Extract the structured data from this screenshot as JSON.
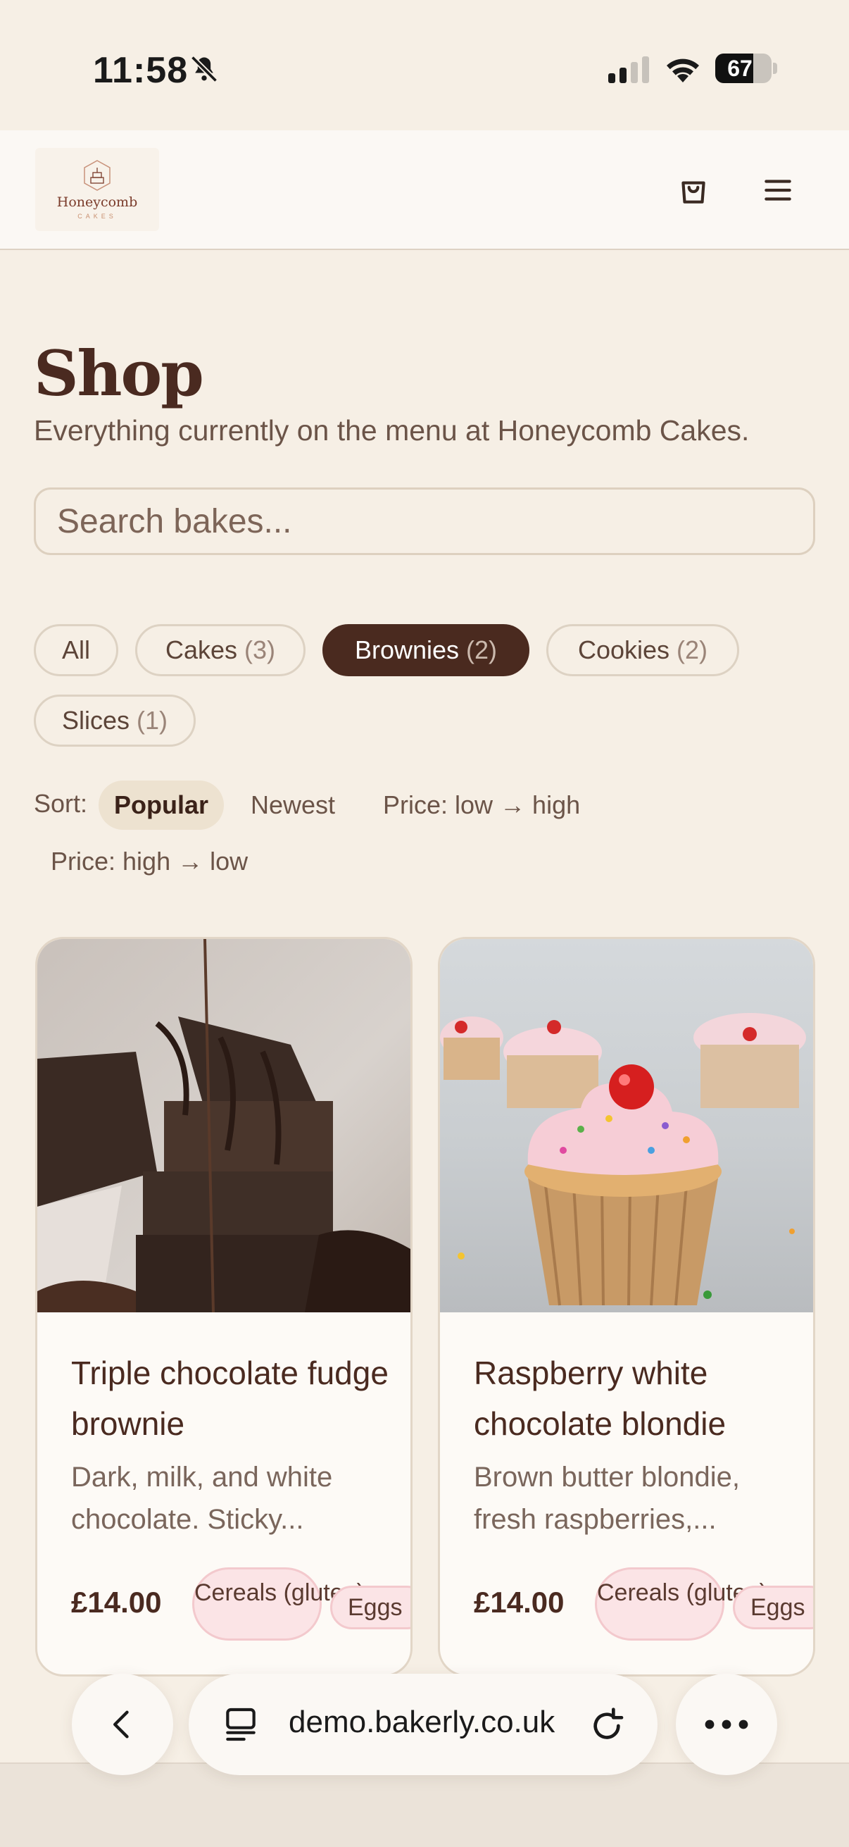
{
  "status_bar": {
    "time": "11:58",
    "battery": "67",
    "battery_level": 0.67
  },
  "header": {
    "logo_text": "Honeycomb",
    "logo_sub": "CAKES"
  },
  "page": {
    "title": "Shop",
    "subtitle": "Everything currently on the menu at Honeycomb Cakes.",
    "search_placeholder": "Search bakes..."
  },
  "filters": [
    {
      "label": "All",
      "count": ""
    },
    {
      "label": "Cakes",
      "count": "(3)"
    },
    {
      "label": "Brownies",
      "count": "(2)"
    },
    {
      "label": "Cookies",
      "count": "(2)"
    },
    {
      "label": "Slices",
      "count": "(1)"
    }
  ],
  "active_filter": "Brownies",
  "sort": {
    "label": "Sort:",
    "options": [
      "Popular",
      "Newest",
      "Price: low → high",
      "Price: high → low"
    ],
    "active": "Popular"
  },
  "products": [
    {
      "name": "Triple chocolate fudge brownie",
      "description": "Dark, milk, and white chocolate. Sticky...",
      "price": "£14.00",
      "tags": [
        "Cereals (gluten)",
        "Eggs"
      ]
    },
    {
      "name": "Raspberry white chocolate blondie",
      "description": "Brown butter blondie, fresh raspberries,...",
      "price": "£14.00",
      "tags": [
        "Cereals (gluten)",
        "Eggs"
      ]
    }
  ],
  "browser": {
    "url": "demo.bakerly.co.uk"
  },
  "icons": [
    "bell-slash-icon",
    "signal-icon",
    "wifi-icon",
    "battery-icon",
    "cart-icon",
    "menu-icon",
    "back-icon",
    "tabs-icon",
    "reload-icon",
    "more-icon"
  ]
}
